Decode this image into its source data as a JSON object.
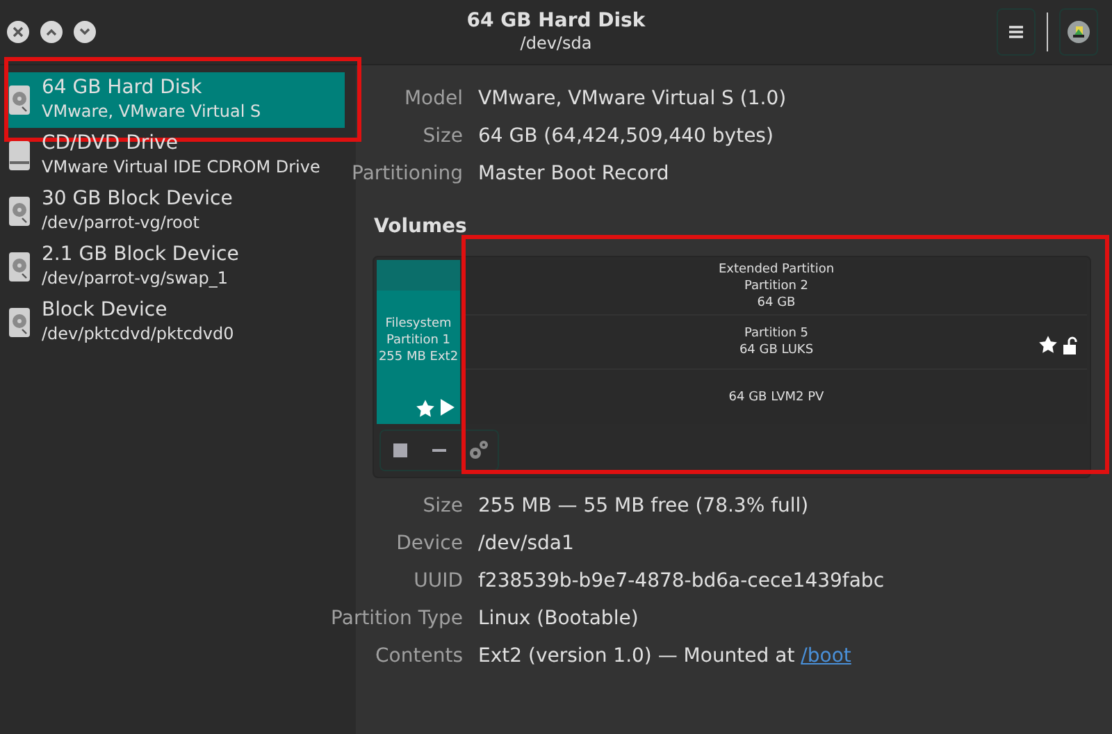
{
  "window": {
    "title": "64 GB Hard Disk",
    "subtitle": "/dev/sda"
  },
  "devices": [
    {
      "kind": "disk",
      "title": "64 GB Hard Disk",
      "subtitle": "VMware, VMware Virtual S",
      "selected": true,
      "highlighted": true
    },
    {
      "kind": "optical",
      "title": "CD/DVD Drive",
      "subtitle": "VMware Virtual IDE CDROM Drive",
      "selected": false,
      "highlighted": false
    },
    {
      "kind": "disk",
      "title": "30 GB Block Device",
      "subtitle": "/dev/parrot-vg/root",
      "selected": false,
      "highlighted": false
    },
    {
      "kind": "disk",
      "title": "2.1 GB Block Device",
      "subtitle": "/dev/parrot-vg/swap_1",
      "selected": false,
      "highlighted": false
    },
    {
      "kind": "disk",
      "title": "Block Device",
      "subtitle": "/dev/pktcdvd/pktcdvd0",
      "selected": false,
      "highlighted": false
    }
  ],
  "disk_details": [
    {
      "label": "Model",
      "value": "VMware, VMware Virtual S (1.0)"
    },
    {
      "label": "Size",
      "value": "64 GB (64,424,509,440 bytes)"
    },
    {
      "label": "Partitioning",
      "value": "Master Boot Record"
    }
  ],
  "volumes": {
    "heading": "Volumes",
    "highlighted": true,
    "partition": {
      "lines": [
        "Filesystem",
        "Partition 1",
        "255 MB Ext2"
      ],
      "selected": true
    },
    "extended": [
      {
        "kind": "extended",
        "lines": [
          "Extended Partition",
          "Partition 2",
          "64 GB"
        ]
      },
      {
        "kind": "luks",
        "lines": [
          "Partition 5",
          "64 GB LUKS"
        ]
      },
      {
        "kind": "lvm",
        "lines": [
          "64 GB LVM2 PV"
        ]
      }
    ]
  },
  "volume_details": [
    {
      "label": "Size",
      "value": "255 MB — 55 MB free (78.3% full)"
    },
    {
      "label": "Device",
      "value": "/dev/sda1"
    },
    {
      "label": "UUID",
      "value": "f238539b-b9e7-4878-bd6a-cece1439fabc"
    },
    {
      "label": "Partition Type",
      "value": "Linux (Bootable)"
    },
    {
      "label": "Contents",
      "value": "Ext2 (version 1.0) — Mounted at ",
      "link": "/boot"
    }
  ]
}
